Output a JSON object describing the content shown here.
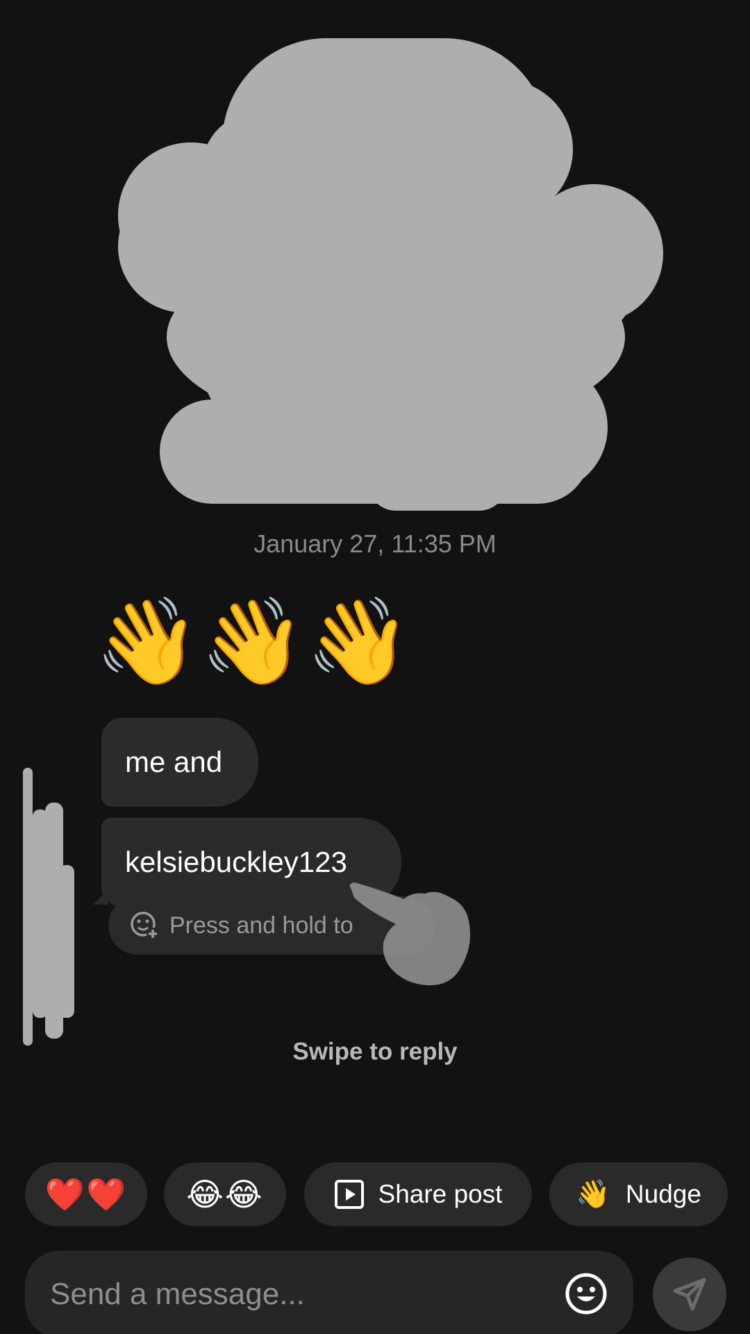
{
  "conversation": {
    "timestamp": "January 27, 11:35 PM",
    "waves": [
      "👋",
      "👋",
      "👋"
    ],
    "messages": [
      {
        "text": "me and"
      },
      {
        "text": "kelsiebuckley123"
      }
    ],
    "tooltip": {
      "text": "Press and hold to",
      "icon": "add-reaction-icon"
    },
    "hint": "Swipe to reply"
  },
  "quick_actions": {
    "hearts": "❤️❤️",
    "laugh": "😂😂",
    "share_post": {
      "label": "Share post",
      "icon": "play-square-icon"
    },
    "nudge": {
      "label": "Nudge",
      "emoji": "👋"
    }
  },
  "composer": {
    "placeholder": "Send a message...",
    "value": "",
    "emoji_icon": "smiley-icon",
    "send_icon": "paper-plane-icon"
  },
  "colors": {
    "background": "#121212",
    "bubble": "#2b2b2b",
    "redaction": "#aeaeae",
    "muted_text": "#8a8a8a"
  }
}
